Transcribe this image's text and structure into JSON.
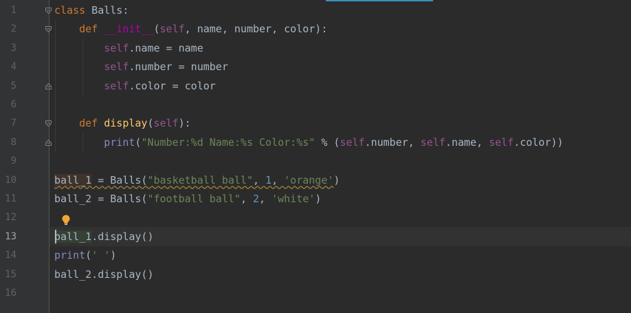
{
  "editor": {
    "line_numbers": [
      "1",
      "2",
      "3",
      "4",
      "5",
      "6",
      "7",
      "8",
      "9",
      "10",
      "11",
      "12",
      "13",
      "14",
      "15",
      "16"
    ],
    "current_line": "13",
    "lines": [
      {
        "n": "1",
        "tokens": [
          {
            "t": "class",
            "c": "kw"
          },
          {
            "t": " Balls:",
            "c": ""
          }
        ]
      },
      {
        "n": "2",
        "tokens": [
          {
            "t": "    ",
            "c": ""
          },
          {
            "t": "def",
            "c": "kw"
          },
          {
            "t": " ",
            "c": ""
          },
          {
            "t": "__init__",
            "c": "dunder"
          },
          {
            "t": "(",
            "c": ""
          },
          {
            "t": "self",
            "c": "selfk"
          },
          {
            "t": ", name, number, color):",
            "c": ""
          }
        ]
      },
      {
        "n": "3",
        "tokens": [
          {
            "t": "        ",
            "c": ""
          },
          {
            "t": "self",
            "c": "selfk"
          },
          {
            "t": ".name = name",
            "c": ""
          }
        ]
      },
      {
        "n": "4",
        "tokens": [
          {
            "t": "        ",
            "c": ""
          },
          {
            "t": "self",
            "c": "selfk"
          },
          {
            "t": ".number = number",
            "c": ""
          }
        ]
      },
      {
        "n": "5",
        "tokens": [
          {
            "t": "        ",
            "c": ""
          },
          {
            "t": "self",
            "c": "selfk"
          },
          {
            "t": ".color = color",
            "c": ""
          }
        ]
      },
      {
        "n": "6",
        "tokens": []
      },
      {
        "n": "7",
        "tokens": [
          {
            "t": "    ",
            "c": ""
          },
          {
            "t": "def",
            "c": "kw"
          },
          {
            "t": " ",
            "c": ""
          },
          {
            "t": "display",
            "c": "fn"
          },
          {
            "t": "(",
            "c": ""
          },
          {
            "t": "self",
            "c": "selfk"
          },
          {
            "t": "):",
            "c": ""
          }
        ]
      },
      {
        "n": "8",
        "tokens": [
          {
            "t": "        ",
            "c": ""
          },
          {
            "t": "print",
            "c": "builtin"
          },
          {
            "t": "(",
            "c": ""
          },
          {
            "t": "\"Number:%d Name:%s Color:%s\"",
            "c": "str"
          },
          {
            "t": " % (",
            "c": ""
          },
          {
            "t": "self",
            "c": "selfk"
          },
          {
            "t": ".number, ",
            "c": ""
          },
          {
            "t": "self",
            "c": "selfk"
          },
          {
            "t": ".name, ",
            "c": ""
          },
          {
            "t": "self",
            "c": "selfk"
          },
          {
            "t": ".color))",
            "c": ""
          }
        ]
      },
      {
        "n": "9",
        "tokens": []
      },
      {
        "n": "10",
        "tokens": [
          {
            "t": "ball_1",
            "c": "usage-hl warn"
          },
          {
            "t": " = Balls(",
            "c": "warn"
          },
          {
            "t": "\"basketball ball\"",
            "c": "str warn"
          },
          {
            "t": ", ",
            "c": "warn"
          },
          {
            "t": "1",
            "c": "num warn"
          },
          {
            "t": ", ",
            "c": "warn"
          },
          {
            "t": "'orange'",
            "c": "str warn"
          },
          {
            "t": ")",
            "c": ""
          }
        ]
      },
      {
        "n": "11",
        "tokens": [
          {
            "t": "ball_2 = Balls(",
            "c": ""
          },
          {
            "t": "\"football ball\"",
            "c": "str"
          },
          {
            "t": ", ",
            "c": ""
          },
          {
            "t": "2",
            "c": "num"
          },
          {
            "t": ", ",
            "c": ""
          },
          {
            "t": "'white'",
            "c": "str"
          },
          {
            "t": ")",
            "c": ""
          }
        ]
      },
      {
        "n": "12",
        "tokens": []
      },
      {
        "n": "13",
        "tokens": [
          {
            "t": "ball_1",
            "c": "caret-hl"
          },
          {
            "t": ".display()",
            "c": ""
          }
        ]
      },
      {
        "n": "14",
        "tokens": [
          {
            "t": "print",
            "c": "builtin"
          },
          {
            "t": "(",
            "c": ""
          },
          {
            "t": "' '",
            "c": "str"
          },
          {
            "t": ")",
            "c": ""
          }
        ]
      },
      {
        "n": "15",
        "tokens": [
          {
            "t": "ball_2.display()",
            "c": ""
          }
        ]
      },
      {
        "n": "16",
        "tokens": []
      }
    ],
    "fold_markers": [
      {
        "line": "1",
        "kind": "open"
      },
      {
        "line": "2",
        "kind": "open"
      },
      {
        "line": "5",
        "kind": "close"
      },
      {
        "line": "7",
        "kind": "open"
      },
      {
        "line": "8",
        "kind": "close"
      }
    ],
    "intention_icon": "lightbulb-icon"
  },
  "colors": {
    "background": "#2b2b2b",
    "gutter": "#313335",
    "keyword": "#cc7832",
    "function": "#ffc66d",
    "string": "#6a8759",
    "number": "#6897bb",
    "self": "#94558d",
    "builtin": "#8888c6",
    "text": "#a9b7c6"
  }
}
